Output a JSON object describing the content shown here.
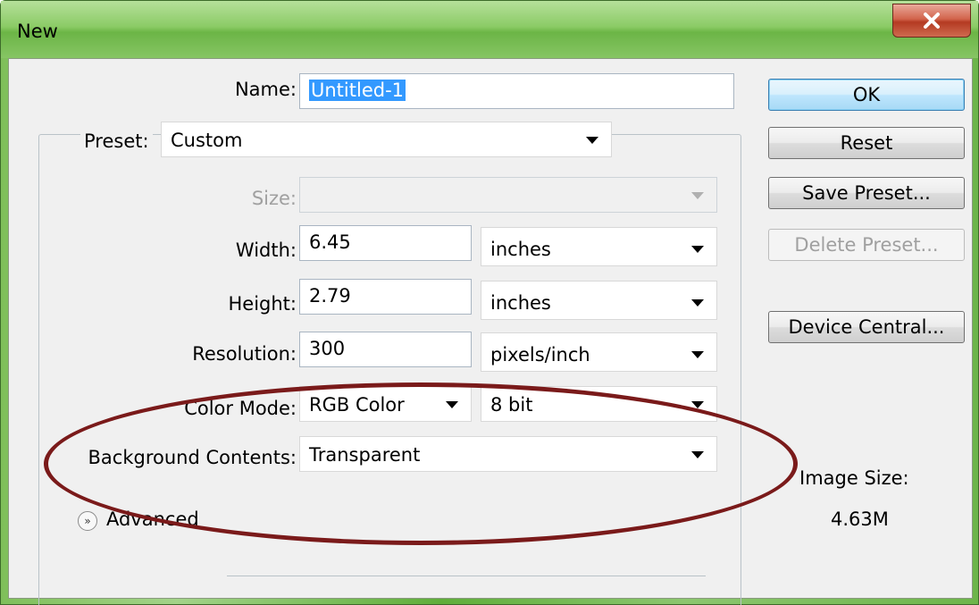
{
  "window": {
    "title": "New"
  },
  "fields": {
    "name_label": "Name:",
    "name_value": "Untitled-1",
    "preset_label": "Preset:",
    "preset_value": "Custom",
    "size_label": "Size:",
    "size_value": "",
    "width_label": "Width:",
    "width_value": "6.45",
    "width_unit": "inches",
    "height_label": "Height:",
    "height_value": "2.79",
    "height_unit": "inches",
    "resolution_label": "Resolution:",
    "resolution_value": "300",
    "resolution_unit": "pixels/inch",
    "color_mode_label": "Color Mode:",
    "color_mode_value": "RGB Color",
    "bit_depth_value": "8 bit",
    "background_label": "Background Contents:",
    "background_value": "Transparent",
    "advanced_label": "Advanced"
  },
  "buttons": {
    "ok": "OK",
    "reset": "Reset",
    "save_preset": "Save Preset...",
    "delete_preset": "Delete Preset...",
    "device_central": "Device Central..."
  },
  "info": {
    "image_size_label": "Image Size:",
    "image_size_value": "4.63M"
  },
  "colors": {
    "annotation_ellipse": "#7a1a1a",
    "title_bar": "#8bcb66",
    "selection": "#3399ff"
  }
}
